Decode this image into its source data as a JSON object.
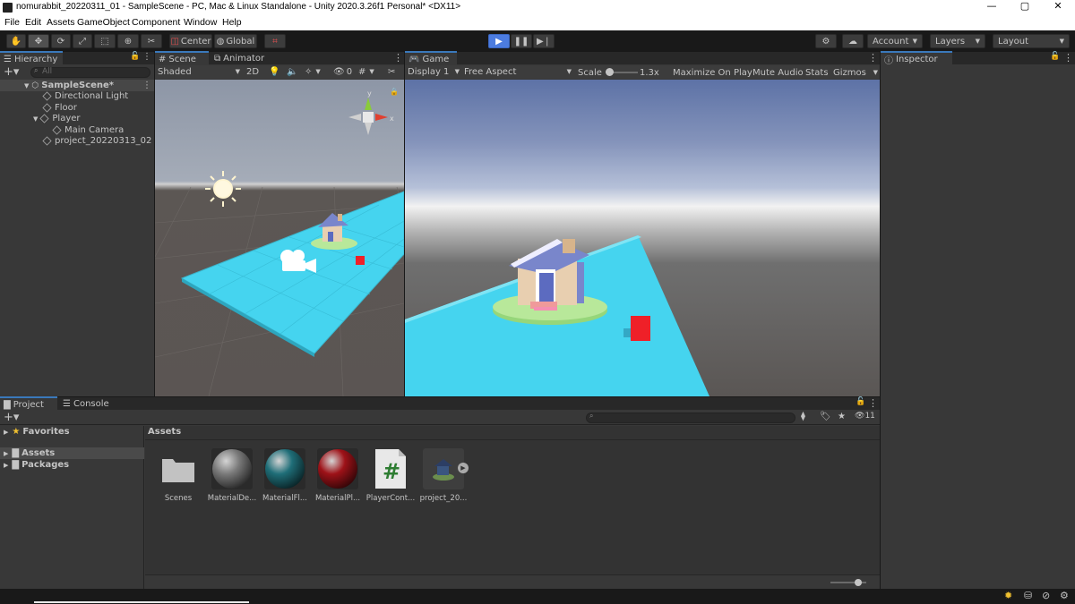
{
  "window": {
    "title": "nomurabbit_20220311_01 - SampleScene - PC, Mac & Linux Standalone - Unity 2020.3.26f1 Personal* <DX11>",
    "controls": [
      "—",
      "▢",
      "✕"
    ]
  },
  "menu": [
    "File",
    "Edit",
    "Assets",
    "GameObject",
    "Component",
    "Window",
    "Help"
  ],
  "toolbar": {
    "pivot_label": "Center",
    "space_label": "Global",
    "account_label": "Account",
    "layers_label": "Layers",
    "layout_label": "Layout"
  },
  "hierarchy": {
    "tab_label": "Hierarchy",
    "search_placeholder": "All",
    "scene_name": "SampleScene*",
    "items": [
      "Directional Light",
      "Floor",
      "Player",
      "Main Camera",
      "project_20220313_02"
    ]
  },
  "scene_view": {
    "tabs": [
      "Scene",
      "Animator"
    ],
    "shading_label": "Shaded",
    "mode_label": "2D",
    "hidden_count": "0",
    "gizmo_axes": {
      "y": "y",
      "x": "x"
    }
  },
  "game_view": {
    "tab_label": "Game",
    "display_label": "Display 1",
    "aspect_label": "Free Aspect",
    "scale_label": "Scale",
    "scale_value": "1.3x",
    "scale_level": 0.1,
    "maximize_label": "Maximize On Play",
    "mute_label": "Mute Audio",
    "stats_label": "Stats",
    "gizmos_label": "Gizmos"
  },
  "inspector": {
    "tab_label": "Inspector"
  },
  "project": {
    "tabs": [
      "Project",
      "Console"
    ],
    "favorites_label": "Favorites",
    "tree": [
      "Assets",
      "Packages"
    ],
    "breadcrumb": "Assets",
    "hidden_count": "11",
    "thumb_size_level": 0.78,
    "assets": [
      {
        "label": "Scenes",
        "kind": "folder"
      },
      {
        "label": "MaterialDe...",
        "kind": "material",
        "color": "#7a7a7a"
      },
      {
        "label": "MaterialFl...",
        "kind": "material",
        "color": "#1f6e78"
      },
      {
        "label": "MaterialPl...",
        "kind": "material",
        "color": "#9e1218"
      },
      {
        "label": "PlayerCont...",
        "kind": "script",
        "color": "#2e7d32"
      },
      {
        "label": "project_20...",
        "kind": "model"
      }
    ]
  },
  "colors": {
    "panel_bg": "#383838",
    "dark_bg": "#282828",
    "selection": "#2c5d87",
    "play_active": "#4c7ce0",
    "floor": "#45d4ef",
    "cube": "#ef2028"
  }
}
